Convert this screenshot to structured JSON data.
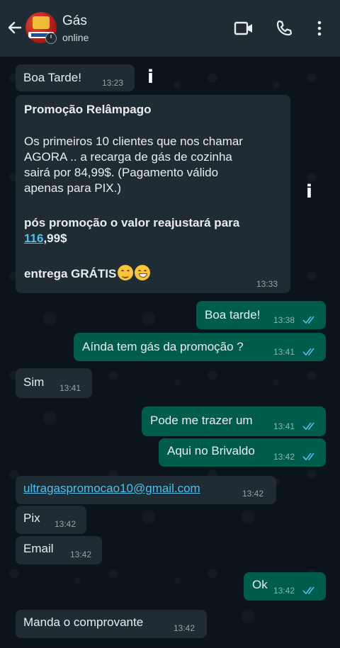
{
  "header": {
    "contact_name": "Gás",
    "status": "online"
  },
  "messages": [
    {
      "dir": "in",
      "text": "Boa Tarde!",
      "time": "13:23"
    },
    {
      "dir": "in",
      "promo": {
        "title": "Promoção Relâmpago",
        "body": [
          "Os primeiros 10 clientes que nos chamar",
          "AGORA .. a recarga de gás de cozinha",
          "sairá por 84,99$. (Pagamento válido",
          "apenas para PIX.)"
        ],
        "after_line1": "pós promoção o valor reajustará para",
        "after_link": "116",
        "after_rest": ",99$",
        "footer": "entrega GRÁTIS"
      },
      "time": "13:33"
    },
    {
      "dir": "out",
      "text": "Boa tarde!",
      "time": "13:38",
      "read": true
    },
    {
      "dir": "out",
      "text": "Aínda tem gás da promoção ?",
      "time": "13:41",
      "read": true
    },
    {
      "dir": "in",
      "text": "Sim",
      "time": "13:41"
    },
    {
      "dir": "out",
      "text": "Pode me trazer um",
      "time": "13:41",
      "read": true
    },
    {
      "dir": "out",
      "text": "Aqui no Brivaldo",
      "time": "13:42",
      "read": true
    },
    {
      "dir": "in",
      "text": "ultragaspromocao10@gmail.com",
      "time": "13:42",
      "is_link": true
    },
    {
      "dir": "in",
      "text": "Pix",
      "time": "13:42"
    },
    {
      "dir": "in",
      "text": "Email",
      "time": "13:42"
    },
    {
      "dir": "out",
      "text": "Ok",
      "time": "13:42",
      "read": true
    },
    {
      "dir": "in",
      "text": "Manda o comprovante",
      "time": "13:42"
    }
  ],
  "colors": {
    "incoming_bubble": "#202c33",
    "outgoing_bubble": "#005c4b",
    "read_ticks": "#53bdeb",
    "header_bg": "#1f2c34"
  },
  "icons": [
    "back-arrow-icon",
    "video-call-icon",
    "voice-call-icon",
    "more-options-icon",
    "info-icon",
    "read-receipt-icon"
  ]
}
